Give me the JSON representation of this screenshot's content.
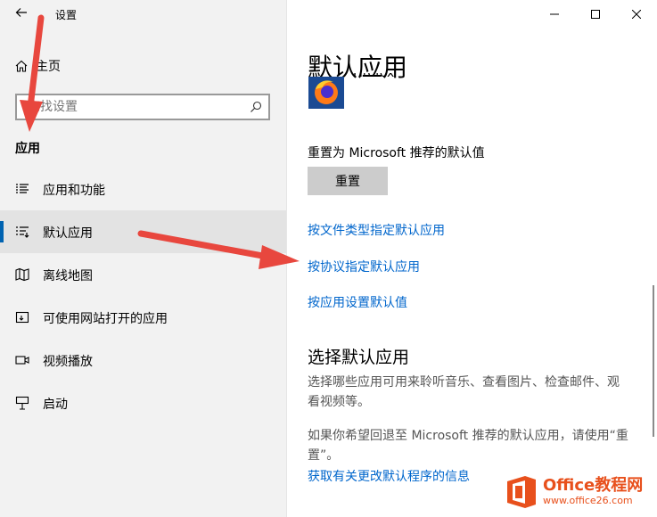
{
  "window": {
    "title": "设置",
    "back_icon": "back-arrow-icon",
    "minimize_icon": "minimize-icon",
    "maximize_icon": "maximize-icon",
    "close_icon": "close-icon"
  },
  "sidebar": {
    "home_label": "主页",
    "search_placeholder": "查找设置",
    "section_title": "应用",
    "items": [
      {
        "label": "应用和功能",
        "icon": "list-icon",
        "active": false
      },
      {
        "label": "默认应用",
        "icon": "default-apps-icon",
        "active": true
      },
      {
        "label": "离线地图",
        "icon": "map-icon",
        "active": false
      },
      {
        "label": "可使用网站打开的应用",
        "icon": "web-apps-icon",
        "active": false
      },
      {
        "label": "视频播放",
        "icon": "video-icon",
        "active": false
      },
      {
        "label": "启动",
        "icon": "startup-icon",
        "active": false
      }
    ]
  },
  "main": {
    "page_title": "默认应用",
    "app_name": "Firefox",
    "reset_label": "重置为 Microsoft 推荐的默认值",
    "reset_button": "重置",
    "links": [
      "按文件类型指定默认应用",
      "按协议指定默认应用",
      "按应用设置默认值"
    ],
    "sub_title": "选择默认应用",
    "desc1": "选择哪些应用可用来聆听音乐、查看图片、检查邮件、观看视频等。",
    "desc2": "如果你希望回退至 Microsoft 推荐的默认应用，请使用“重置”。",
    "info_link": "获取有关更改默认程序的信息"
  },
  "watermark": {
    "brand": "Office教程网",
    "url": "www.office26.com"
  },
  "colors": {
    "accent": "#0063b1",
    "link": "#0066cc",
    "annotation_arrow": "#e8473e",
    "watermark": "#e8501c"
  }
}
